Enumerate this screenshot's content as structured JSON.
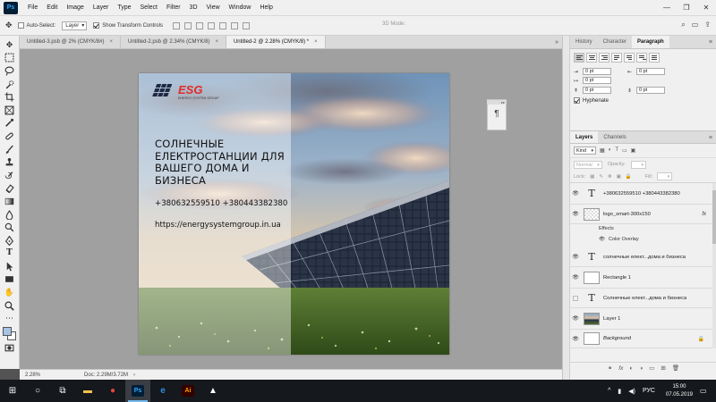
{
  "app": {
    "logo": "Ps"
  },
  "menu": [
    "File",
    "Edit",
    "Image",
    "Layer",
    "Type",
    "Select",
    "Filter",
    "3D",
    "View",
    "Window",
    "Help"
  ],
  "window_controls": {
    "minimize": "—",
    "maximize": "❐",
    "close": "✕"
  },
  "options": {
    "auto_select_label": "Auto-Select:",
    "auto_select_checked": false,
    "auto_select_value": "Layer",
    "transform_label": "Show Transform Controls",
    "transform_checked": true,
    "mode_label": "3D Mode:"
  },
  "tabs": [
    {
      "label": "Untitled-3.psb @ 2% (CMYK/8#)",
      "close": "×",
      "active": false
    },
    {
      "label": "Untitled-2.psb @ 2.34% (CMYK/8)",
      "close": "×",
      "active": false
    },
    {
      "label": "Untitled-2 @ 2.28% (CMYK/8) *",
      "close": "×",
      "active": true
    }
  ],
  "tab_collapse": "»",
  "artboard": {
    "logo_name": "ESG",
    "logo_subtitle": "ENERGY SYSTEM GROUP",
    "headline": "СОЛНЕЧНЫЕ ЕЛЕКТРОСТАНЦИИ ДЛЯ ВАШЕГО ДОМА И БИЗНЕСА",
    "phones": "+380632559510 +380443382380",
    "website": "https://energysystemgroup.in.ua"
  },
  "status": {
    "zoom": "2.28%",
    "doc_size": "Doc: 2.29M/3.72M",
    "arrow": "›"
  },
  "panel_top": {
    "tabs": [
      "History",
      "Character",
      "Paragraph"
    ],
    "active": "Paragraph",
    "indent_left": "0 pt",
    "indent_right": "0 pt",
    "indent_first": "0 pt",
    "space_before": "0 pt",
    "space_after": "0 pt",
    "hyphenate_label": "Hyphenate",
    "hyphenate_checked": true,
    "menu_icon": "≡"
  },
  "layers_panel": {
    "tabs": [
      "Layers",
      "Channels"
    ],
    "active": "Layers",
    "menu_icon": "≡",
    "filter_kind": "Kind",
    "blend_mode": "Normal",
    "opacity_label": "Opacity:",
    "lock_label": "Lock:",
    "fill_label": "Fill:",
    "rows": [
      {
        "type": "text",
        "name": "+380632559510 +380443382380",
        "visible": true,
        "italic": false,
        "thumb": "text"
      },
      {
        "type": "smart",
        "name": "logo_smart-300x150",
        "visible": true,
        "italic": false,
        "thumb": "image",
        "fx": "fx"
      },
      {
        "type": "sub",
        "name": "Effects"
      },
      {
        "type": "sub",
        "name": "Color Overlay"
      },
      {
        "type": "text",
        "name": "солнечные елект...дома и бизнеса",
        "visible": true,
        "italic": false,
        "thumb": "text"
      },
      {
        "type": "shape",
        "name": "Rectangle 1",
        "visible": true,
        "italic": false,
        "thumb": "shape"
      },
      {
        "type": "text",
        "name": "Солнечные елект...дома и бизнеса",
        "visible": false,
        "italic": false,
        "thumb": "text"
      },
      {
        "type": "image",
        "name": "Layer 1",
        "visible": true,
        "italic": false,
        "thumb": "photo"
      },
      {
        "type": "bg",
        "name": "Background",
        "visible": true,
        "italic": true,
        "thumb": "white",
        "lock": "🔒"
      }
    ],
    "footer_icons": [
      "⚭",
      "fx",
      "◐",
      "◑",
      "▭",
      "⊞",
      "🗑"
    ]
  },
  "taskbar": {
    "clock_time": "15:00",
    "clock_date": "07.05.2019",
    "language": "РУС",
    "tray_up": "^",
    "apps": [
      {
        "name": "start-button",
        "label": "⊞",
        "color": "#ffffff",
        "active": false
      },
      {
        "name": "search-button",
        "label": "○",
        "color": "#ffffff",
        "active": false
      },
      {
        "name": "task-view-button",
        "label": "⧉",
        "color": "#ffffff",
        "active": false
      },
      {
        "name": "file-explorer-app",
        "label": "▬",
        "color": "#f2c14e",
        "active": false
      },
      {
        "name": "chrome-app",
        "label": "●",
        "color": "#e0463b",
        "active": false
      },
      {
        "name": "photoshop-app",
        "label": "Ps",
        "color": "#31a8ff",
        "active": true
      },
      {
        "name": "edge-app",
        "label": "e",
        "color": "#2f8de4",
        "active": false
      },
      {
        "name": "illustrator-app",
        "label": "Ai",
        "color": "#ff9a00",
        "active": false
      },
      {
        "name": "photos-app",
        "label": "▲",
        "color": "#ffffff",
        "active": false
      }
    ]
  },
  "colors": {
    "foreground": "#a7c4e6",
    "background": "#ffffff",
    "logo_red": "#e22b2b",
    "accent_blue": "#31a8ff"
  }
}
